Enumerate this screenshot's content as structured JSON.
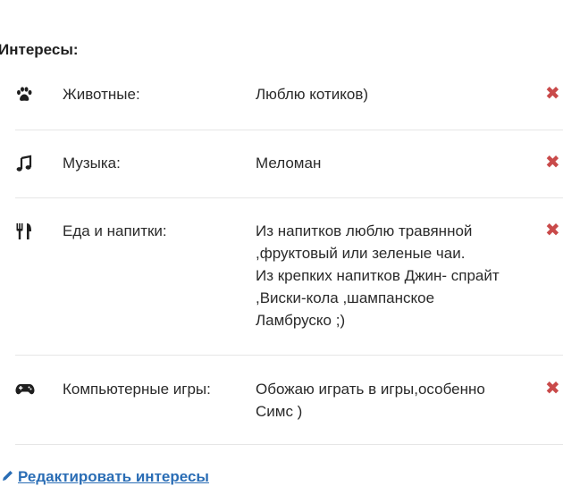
{
  "section_title": "Интересы:",
  "interests": [
    {
      "icon": "paw-icon",
      "label": "Животные:",
      "value": [
        "Люблю котиков)"
      ]
    },
    {
      "icon": "music-note-icon",
      "label": "Музыка:",
      "value": [
        "Меломан"
      ]
    },
    {
      "icon": "fork-knife-icon",
      "label": "Еда и напитки:",
      "value": [
        "Из напитков люблю травянной",
        ",фруктовый или зеленые чаи.",
        "Из крепких напитков Джин- спрайт",
        ",Виски-кола ,шампанское",
        "Ламбруско ;)"
      ]
    },
    {
      "icon": "gamepad-icon",
      "label": "Компьютерные игры:",
      "value": [
        "Обожаю играть в игры,особенно",
        "Симс )"
      ]
    }
  ],
  "delete_symbol": "✖",
  "edit_link_text": "Редактировать интересы",
  "colors": {
    "delete": "#c94a4a",
    "link": "#2a6db5",
    "divider": "#e6e6e6"
  }
}
